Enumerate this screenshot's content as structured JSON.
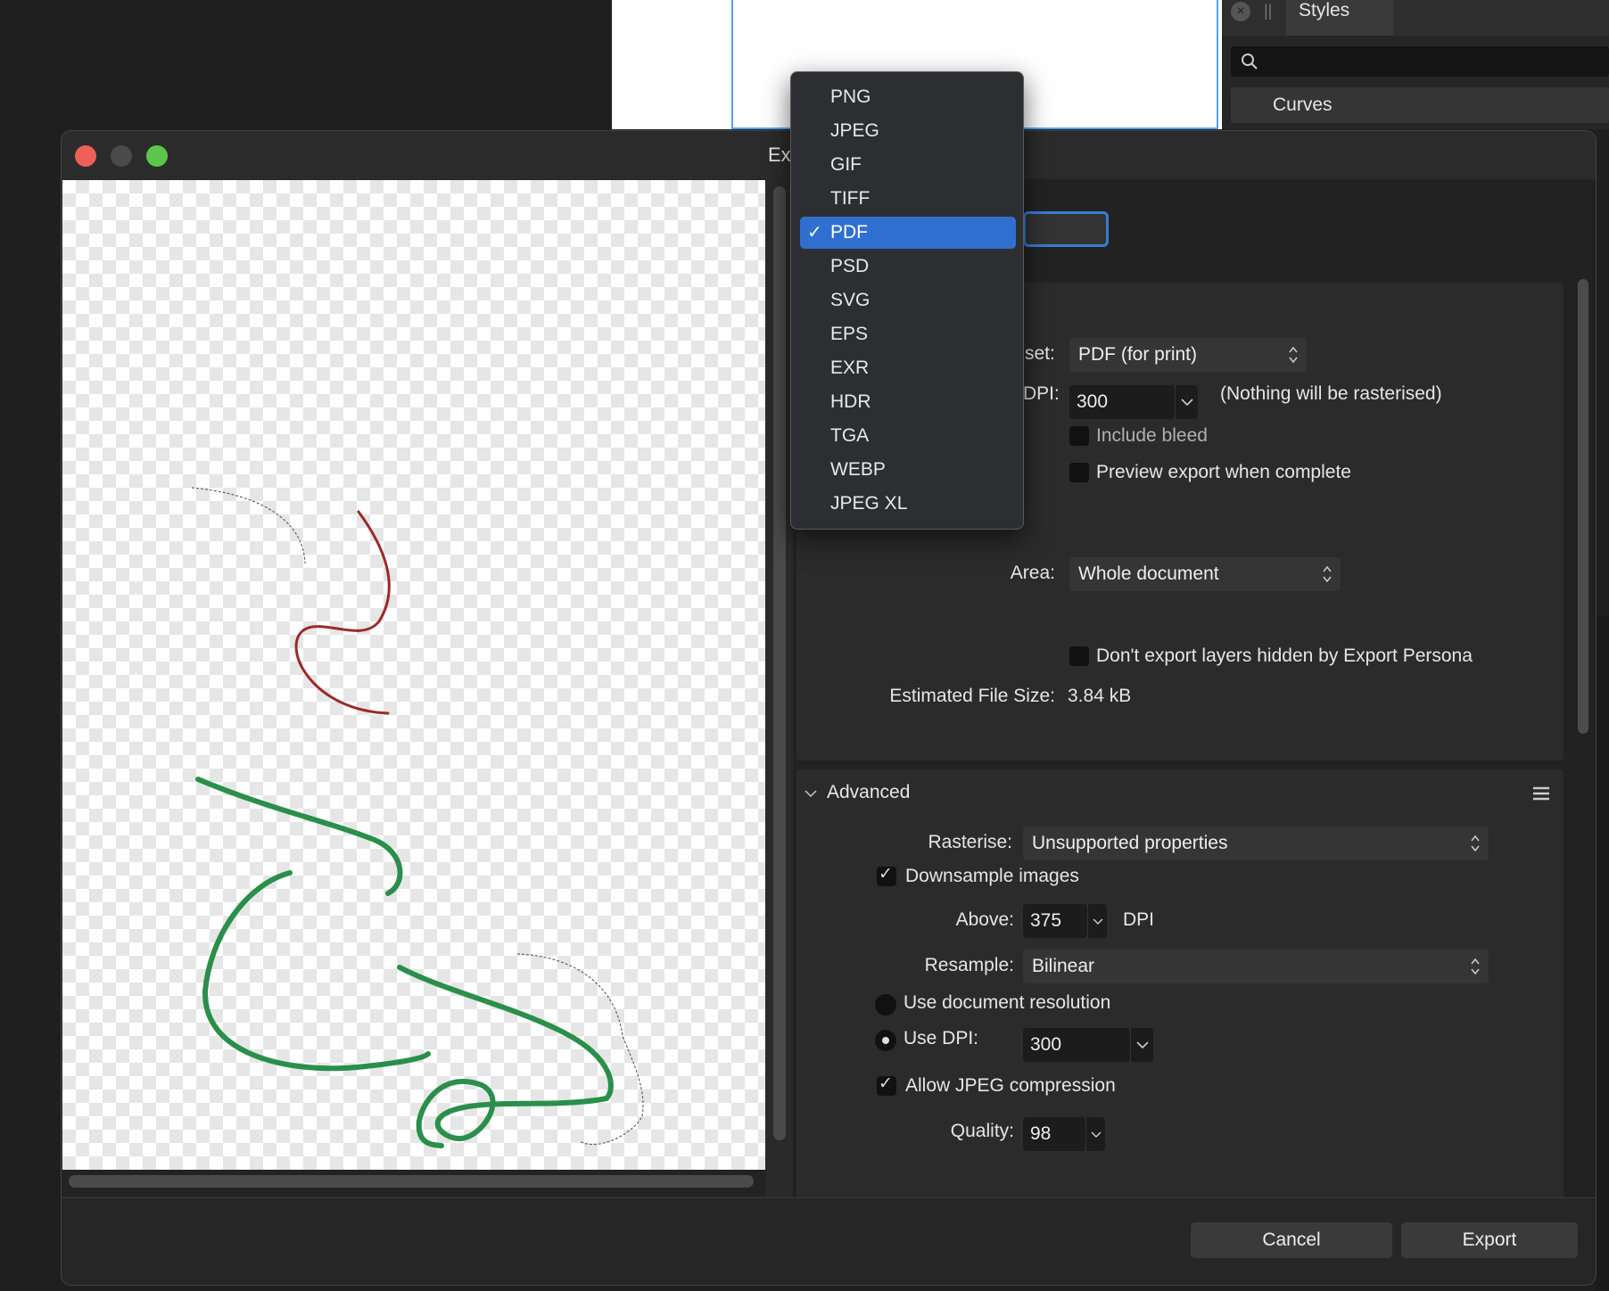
{
  "background_app": {
    "styles_panel": {
      "close_icon": "close-circle-icon",
      "grip": "||",
      "tab_label": "Styles",
      "search_placeholder": "",
      "category": "Curves"
    }
  },
  "dialog": {
    "title": "Ex",
    "colors": {
      "accent": "#2f6fd0",
      "stroke_green": "#2a8f4a",
      "stroke_red": "#9b2a2a"
    },
    "settings": {
      "preset_label": "set:",
      "preset_value": "PDF (for print)",
      "dpi_label": "DPI:",
      "dpi_value": "300",
      "dpi_note": "(Nothing will be rasterised)",
      "include_bleed": {
        "label": "Include bleed",
        "checked": false
      },
      "preview_export": {
        "label": "Preview export when complete",
        "checked": false
      },
      "area_label": "Area:",
      "area_value": "Whole document",
      "dont_export_hidden": {
        "label": "Don't export layers hidden by Export Persona",
        "checked": false
      },
      "file_size_label": "Estimated File Size:",
      "file_size_value": "3.84 kB"
    },
    "advanced": {
      "title": "Advanced",
      "rasterise_label": "Rasterise:",
      "rasterise_value": "Unsupported properties",
      "downsample": {
        "label": "Downsample images",
        "checked": true
      },
      "above_label": "Above:",
      "above_value": "375",
      "above_unit": "DPI",
      "resample_label": "Resample:",
      "resample_value": "Bilinear",
      "use_doc_res": {
        "label": "Use document resolution",
        "selected": false
      },
      "use_dpi": {
        "label": "Use DPI:",
        "selected": true,
        "value": "300"
      },
      "allow_jpeg": {
        "label": "Allow JPEG compression",
        "checked": true
      },
      "quality_label": "Quality:",
      "quality_value": "98"
    },
    "buttons": {
      "cancel": "Cancel",
      "export": "Export"
    }
  },
  "format_menu": {
    "selected": "PDF",
    "items": [
      "PNG",
      "JPEG",
      "GIF",
      "TIFF",
      "PDF",
      "PSD",
      "SVG",
      "EPS",
      "EXR",
      "HDR",
      "TGA",
      "WEBP",
      "JPEG XL"
    ]
  }
}
